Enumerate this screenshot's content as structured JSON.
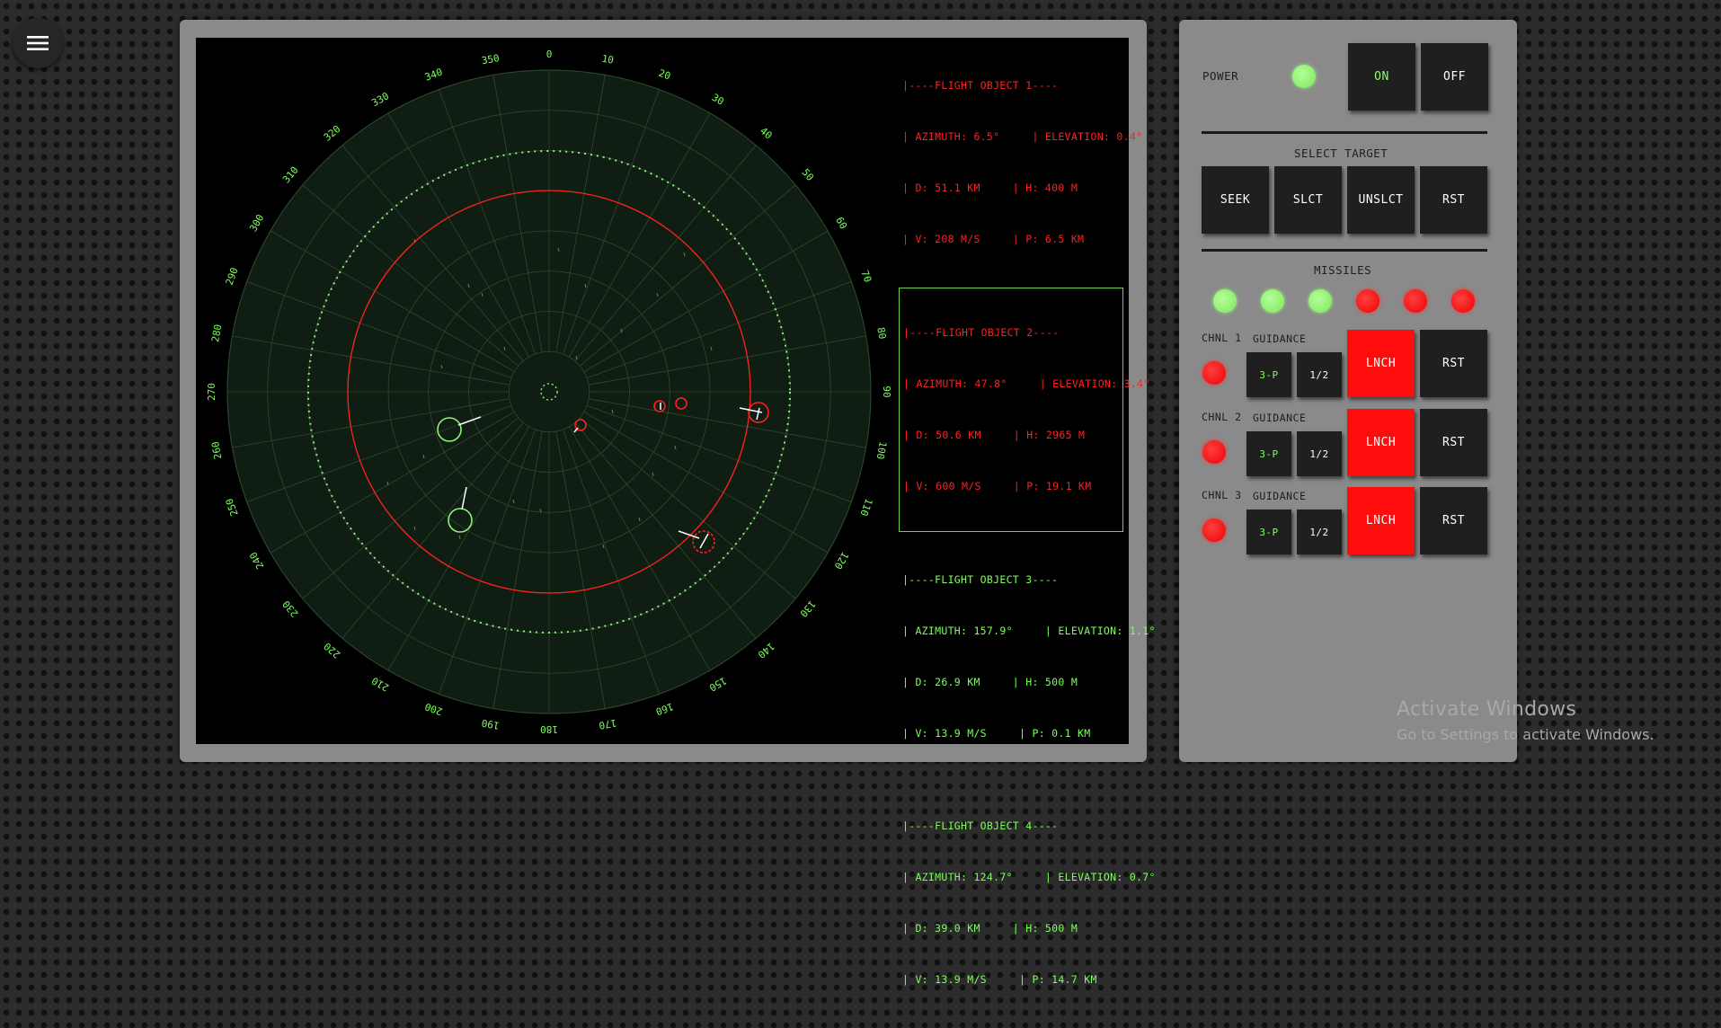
{
  "menu": {
    "icon": "hamburger-menu-icon"
  },
  "radar": {
    "bearing_labels": [
      "0",
      "10",
      "20",
      "30",
      "40",
      "50",
      "60",
      "70",
      "80",
      "90",
      "100",
      "110",
      "120",
      "130",
      "140",
      "150",
      "160",
      "170",
      "180",
      "190",
      "200",
      "210",
      "220",
      "230",
      "240",
      "250",
      "260",
      "270",
      "280",
      "290",
      "300",
      "310",
      "320",
      "330",
      "340",
      "350"
    ],
    "colors": {
      "grid": "#2e4a2e",
      "scope_fill": "#0f1d12",
      "label": "#7cff5a",
      "hostile": "#ff2020",
      "friendly": "#8ff07a",
      "vector": "#ffffff"
    }
  },
  "flight_objects": [
    {
      "header": "|----FLIGHT OBJECT 1----",
      "line1": "| AZIMUTH: 6.5°     | ELEVATION: 0.4°",
      "line2": "| D: 51.1 KM     | H: 400 M",
      "line3": "| V: 208 M/S     | P: 6.5 KM",
      "color": "red",
      "selected": false
    },
    {
      "header": "|----FLIGHT OBJECT 2----",
      "line1": "| AZIMUTH: 47.8°     | ELEVATION: 3.4°",
      "line2": "| D: 50.6 KM     | H: 2965 M",
      "line3": "| V: 600 M/S     | P: 19.1 KM",
      "color": "red",
      "selected": true
    },
    {
      "header": "|----FLIGHT OBJECT 3----",
      "line1": "| AZIMUTH: 157.9°     | ELEVATION: 1.1°",
      "line2": "| D: 26.9 KM     | H: 500 M",
      "line3": "| V: 13.9 M/S     | P: 0.1 KM",
      "color": "green",
      "selected": false
    },
    {
      "header": "|----FLIGHT OBJECT 4----",
      "line1": "| AZIMUTH: 124.7°     | ELEVATION: 0.7°",
      "line2": "| D: 39.0 KM     | H: 500 M",
      "line3": "| V: 13.9 M/S     | P: 14.7 KM",
      "color": "green",
      "selected": false
    }
  ],
  "controls": {
    "power_label": "POWER",
    "on_label": "ON",
    "off_label": "OFF",
    "select_target_label": "SELECT TARGET",
    "seek_label": "SEEK",
    "slct_label": "SLCT",
    "unslct_label": "UNSLCT",
    "rst_label": "RST",
    "missiles_label": "MISSILES",
    "missile_status": [
      "ready",
      "ready",
      "ready",
      "spent",
      "spent",
      "spent"
    ],
    "channels": [
      {
        "name": "CHNL 1",
        "guidance_label": "GUIDANCE",
        "mode_a": "3-P",
        "mode_b": "1/2",
        "launch_label": "LNCH",
        "reset_label": "RST",
        "status": "red"
      },
      {
        "name": "CHNL 2",
        "guidance_label": "GUIDANCE",
        "mode_a": "3-P",
        "mode_b": "1/2",
        "launch_label": "LNCH",
        "reset_label": "RST",
        "status": "red"
      },
      {
        "name": "CHNL 3",
        "guidance_label": "GUIDANCE",
        "mode_a": "3-P",
        "mode_b": "1/2",
        "launch_label": "LNCH",
        "reset_label": "RST",
        "status": "red"
      }
    ]
  },
  "watermark": {
    "title": "Activate Windows",
    "subtitle": "Go to Settings to activate Windows."
  }
}
